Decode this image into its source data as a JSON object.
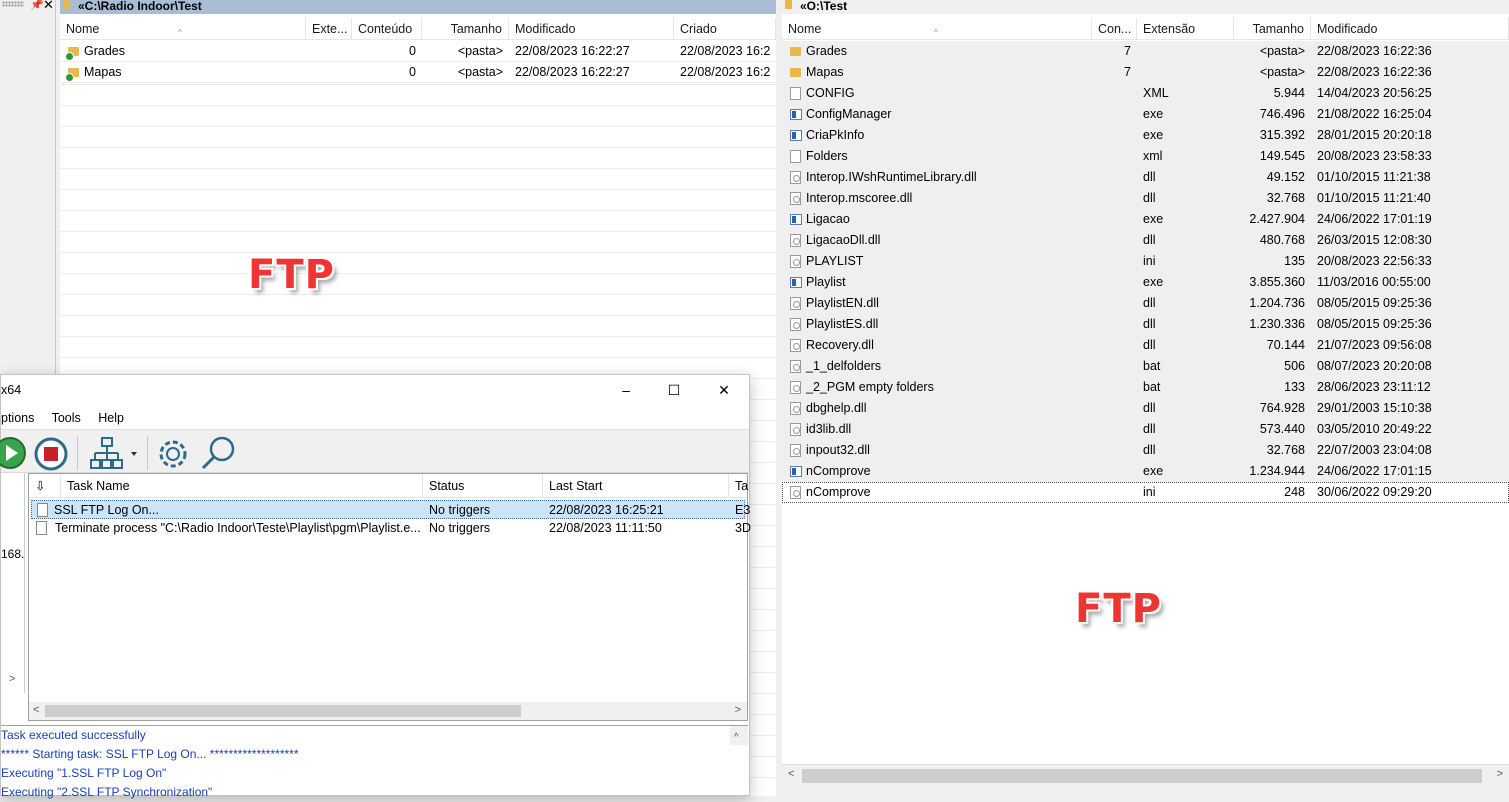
{
  "left_panel": {
    "path": "«C:\\Radio Indoor\\Test",
    "columns": [
      "Nome",
      "Exte...",
      "Conteúdo",
      "Tamanho",
      "Modificado",
      "Criado"
    ],
    "rows": [
      {
        "name": "Grades",
        "ext": "",
        "content": "0",
        "size": "<pasta>",
        "modified": "22/08/2023 16:22:27",
        "created": "22/08/2023 16:2"
      },
      {
        "name": "Mapas",
        "ext": "",
        "content": "0",
        "size": "<pasta>",
        "modified": "22/08/2023 16:22:27",
        "created": "22/08/2023 16:2"
      }
    ],
    "stamp": "FTP"
  },
  "right_panel": {
    "path": "«O:\\Test",
    "columns": [
      "Nome",
      "Con...",
      "Extensão",
      "Tamanho",
      "Modificado"
    ],
    "rows": [
      {
        "icon": "folder-icon",
        "name": "Grades",
        "count": "7",
        "ext": "",
        "size": "<pasta>",
        "modified": "22/08/2023 16:22:36"
      },
      {
        "icon": "folder-icon",
        "name": "Mapas",
        "count": "7",
        "ext": "",
        "size": "<pasta>",
        "modified": "22/08/2023 16:22:36"
      },
      {
        "icon": "file-icon",
        "name": "CONFIG",
        "count": "",
        "ext": "XML",
        "size": "5.944",
        "modified": "14/04/2023 20:56:25"
      },
      {
        "icon": "exe-icon",
        "name": "ConfigManager",
        "count": "",
        "ext": "exe",
        "size": "746.496",
        "modified": "21/08/2022 16:25:04"
      },
      {
        "icon": "exe-icon",
        "name": "CriaPkInfo",
        "count": "",
        "ext": "exe",
        "size": "315.392",
        "modified": "28/01/2015 20:20:18"
      },
      {
        "icon": "file-icon",
        "name": "Folders",
        "count": "",
        "ext": "xml",
        "size": "149.545",
        "modified": "20/08/2023 23:58:33"
      },
      {
        "icon": "cfg-icon",
        "name": "Interop.IWshRuntimeLibrary.dll",
        "count": "",
        "ext": "dll",
        "size": "49.152",
        "modified": "01/10/2015 11:21:38"
      },
      {
        "icon": "cfg-icon",
        "name": "Interop.mscoree.dll",
        "count": "",
        "ext": "dll",
        "size": "32.768",
        "modified": "01/10/2015 11:21:40"
      },
      {
        "icon": "exe-icon",
        "name": "Ligacao",
        "count": "",
        "ext": "exe",
        "size": "2.427.904",
        "modified": "24/06/2022 17:01:19"
      },
      {
        "icon": "cfg-icon",
        "name": "LigacaoDll.dll",
        "count": "",
        "ext": "dll",
        "size": "480.768",
        "modified": "26/03/2015 12:08:30"
      },
      {
        "icon": "cfg-icon",
        "name": "PLAYLIST",
        "count": "",
        "ext": "ini",
        "size": "135",
        "modified": "20/08/2023 22:56:33"
      },
      {
        "icon": "exe-icon",
        "name": "Playlist",
        "count": "",
        "ext": "exe",
        "size": "3.855.360",
        "modified": "11/03/2016 00:55:00"
      },
      {
        "icon": "cfg-icon",
        "name": "PlaylistEN.dll",
        "count": "",
        "ext": "dll",
        "size": "1.204.736",
        "modified": "08/05/2015 09:25:36"
      },
      {
        "icon": "cfg-icon",
        "name": "PlaylistES.dll",
        "count": "",
        "ext": "dll",
        "size": "1.230.336",
        "modified": "08/05/2015 09:25:36"
      },
      {
        "icon": "cfg-icon",
        "name": "Recovery.dll",
        "count": "",
        "ext": "dll",
        "size": "70.144",
        "modified": "21/07/2023 09:56:08"
      },
      {
        "icon": "cfg-icon",
        "name": "_1_delfolders",
        "count": "",
        "ext": "bat",
        "size": "506",
        "modified": "08/07/2023 20:20:08"
      },
      {
        "icon": "cfg-icon",
        "name": "_2_PGM empty folders",
        "count": "",
        "ext": "bat",
        "size": "133",
        "modified": "28/06/2023 23:11:12"
      },
      {
        "icon": "cfg-icon",
        "name": "dbghelp.dll",
        "count": "",
        "ext": "dll",
        "size": "764.928",
        "modified": "29/01/2003 15:10:38"
      },
      {
        "icon": "cfg-icon",
        "name": "id3lib.dll",
        "count": "",
        "ext": "dll",
        "size": "573.440",
        "modified": "03/05/2010 20:49:22"
      },
      {
        "icon": "cfg-icon",
        "name": "inpout32.dll",
        "count": "",
        "ext": "dll",
        "size": "32.768",
        "modified": "22/07/2003 23:04:08"
      },
      {
        "icon": "exe-icon",
        "name": "nComprove",
        "count": "",
        "ext": "exe",
        "size": "1.234.944",
        "modified": "24/06/2022 17:01:15"
      },
      {
        "icon": "cfg-icon",
        "name": "nComprove",
        "count": "",
        "ext": "ini",
        "size": "248",
        "modified": "30/06/2022 09:29:20"
      }
    ],
    "stamp": "FTP"
  },
  "task_window": {
    "title": "x64",
    "controls": {
      "minimize": "–",
      "maximize": "☐",
      "close": "✕"
    },
    "menu": [
      "ptions",
      "Tools",
      "Help"
    ],
    "left_partial_text": "168.",
    "list_columns": [
      "Task Name",
      "Status",
      "Last Start",
      "Ta"
    ],
    "tasks": [
      {
        "name": "SSL FTP Log On...",
        "status": "No triggers",
        "last_start": "22/08/2023 16:25:21",
        "ta": "E3"
      },
      {
        "name": "Terminate process \"C:\\Radio Indoor\\Teste\\Playlist\\pgm\\Playlist.e...",
        "status": "No triggers",
        "last_start": "22/08/2023 11:11:50",
        "ta": "3D"
      }
    ],
    "log": [
      "Task executed successfully",
      "****** Starting task: SSL FTP Log On... *******************",
      "Executing \"1.SSL FTP Log On\"",
      "Executing \"2.SSL FTP Synchronization\""
    ]
  }
}
